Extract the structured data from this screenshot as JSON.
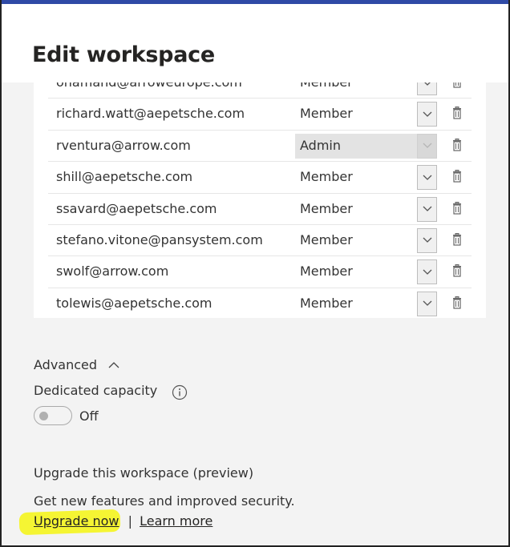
{
  "header": {
    "title": "Edit workspace"
  },
  "members": [
    {
      "email": "ohamand@arroweurope.com",
      "role": "Member"
    },
    {
      "email": "richard.watt@aepetsche.com",
      "role": "Member"
    },
    {
      "email": "rventura@arrow.com",
      "role": "Admin"
    },
    {
      "email": "shill@aepetsche.com",
      "role": "Member"
    },
    {
      "email": "ssavard@aepetsche.com",
      "role": "Member"
    },
    {
      "email": "stefano.vitone@pansystem.com",
      "role": "Member"
    },
    {
      "email": "swolf@arrow.com",
      "role": "Member"
    },
    {
      "email": "tolewis@aepetsche.com",
      "role": "Member"
    }
  ],
  "advanced": {
    "label": "Advanced",
    "dedicated_capacity": "Dedicated capacity",
    "toggle_state": "Off"
  },
  "upgrade": {
    "heading": "Upgrade this workspace (preview)",
    "description": "Get new features and improved security.",
    "upgrade_link": "Upgrade now",
    "separator": "|",
    "learn_link": "Learn more"
  },
  "colors": {
    "top_bar": "#2f4aa6",
    "highlight": "#f5f533"
  }
}
